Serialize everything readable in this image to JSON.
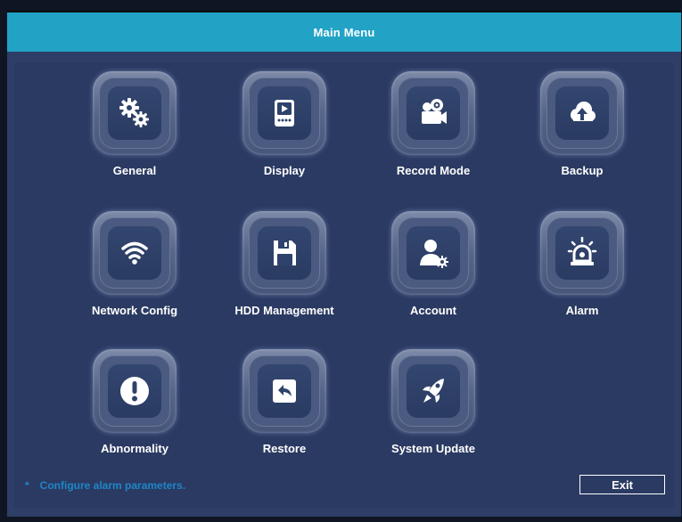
{
  "window": {
    "title": "Main Menu"
  },
  "menu_items": [
    {
      "label": "General",
      "icon": "gears-icon"
    },
    {
      "label": "Display",
      "icon": "display-icon"
    },
    {
      "label": "Record Mode",
      "icon": "camera-icon"
    },
    {
      "label": "Backup",
      "icon": "cloud-upload-icon"
    },
    {
      "label": "Network Config",
      "icon": "wifi-icon"
    },
    {
      "label": "HDD Management",
      "icon": "floppy-icon"
    },
    {
      "label": "Account",
      "icon": "user-gear-icon"
    },
    {
      "label": "Alarm",
      "icon": "alarm-light-icon"
    },
    {
      "label": "Abnormality",
      "icon": "exclamation-icon"
    },
    {
      "label": "Restore",
      "icon": "restore-arrow-icon"
    },
    {
      "label": "System Update",
      "icon": "rocket-icon"
    }
  ],
  "footer": {
    "hint_marker": "*",
    "hint_text": "Configure alarm parameters.",
    "exit_label": "Exit"
  },
  "colors": {
    "title_bar": "#22a3c6",
    "background": "#2e3e66",
    "hint_text": "#1e86c8"
  }
}
